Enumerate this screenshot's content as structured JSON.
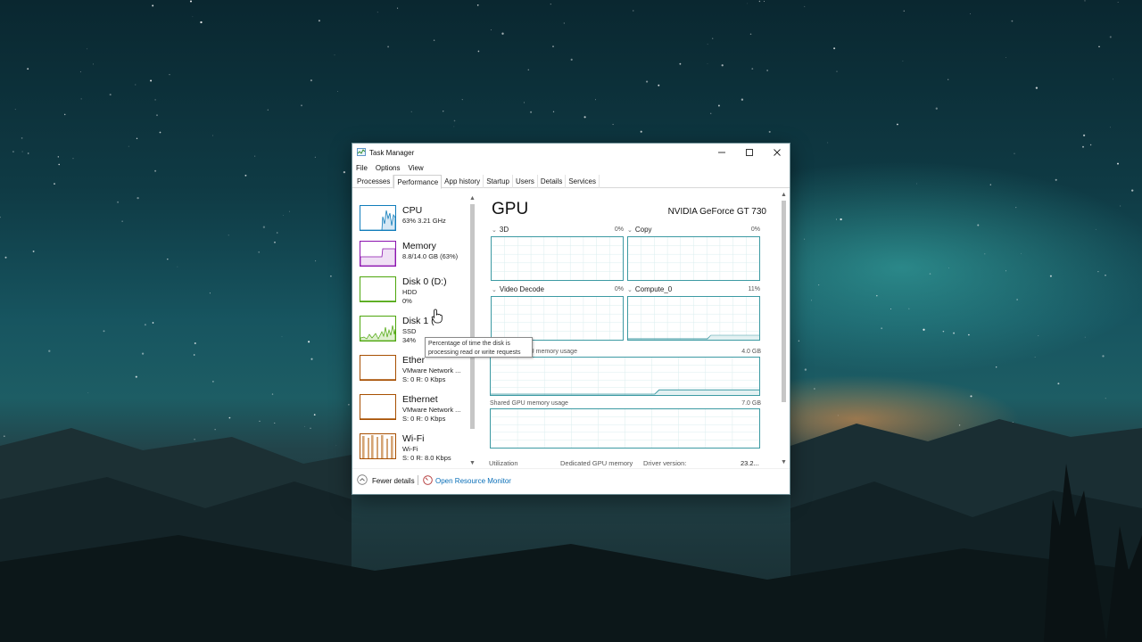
{
  "window": {
    "title": "Task Manager"
  },
  "menu": [
    "File",
    "Options",
    "View"
  ],
  "tabs": [
    "Processes",
    "Performance",
    "App history",
    "Startup",
    "Users",
    "Details",
    "Services"
  ],
  "active_tab": "Performance",
  "resources": [
    {
      "name": "CPU",
      "line1": "63%  3.21 GHz",
      "line2": "",
      "border_color": "#117dbb"
    },
    {
      "name": "Memory",
      "line1": "8.8/14.0 GB (63%)",
      "line2": "",
      "border_color": "#8b12ae"
    },
    {
      "name": "Disk 0 (D:)",
      "line1": "HDD",
      "line2": "0%",
      "border_color": "#4da60c"
    },
    {
      "name": "Disk 1 (",
      "line1": "SSD",
      "line2": "34%",
      "border_color": "#4da60c"
    },
    {
      "name": "Ether",
      "line1": "VMware Network ...",
      "line2": "S: 0  R: 0 Kbps",
      "border_color": "#a74f01"
    },
    {
      "name": "Ethernet",
      "line1": "VMware Network ...",
      "line2": "S: 0  R: 0 Kbps",
      "border_color": "#a74f01"
    },
    {
      "name": "Wi-Fi",
      "line1": "Wi-Fi",
      "line2": "S: 0  R: 8.0 Kbps",
      "border_color": "#a74f01"
    }
  ],
  "tooltip": {
    "line1": "Percentage of time the disk is",
    "line2": "processing read or write requests"
  },
  "gpu": {
    "title": "GPU",
    "model": "NVIDIA GeForce GT 730",
    "engines": [
      {
        "label": "3D",
        "value": "0%"
      },
      {
        "label": "Copy",
        "value": "0%"
      },
      {
        "label": "Video Decode",
        "value": "0%"
      },
      {
        "label": "Compute_0",
        "value": "11%"
      }
    ],
    "dedicated": {
      "label": "PU memory usage",
      "max": "4.0 GB"
    },
    "shared": {
      "label": "Shared GPU memory usage",
      "max": "7.0 GB"
    },
    "footer": {
      "utilization": "Utilization",
      "dedicated": "Dedicated GPU memory",
      "driver": "Driver version:",
      "driver_value": "23.2..."
    },
    "graph_color": "#3d9aa3"
  },
  "footer": {
    "fewer_details": "Fewer details",
    "open_resource_monitor": "Open Resource Monitor"
  }
}
